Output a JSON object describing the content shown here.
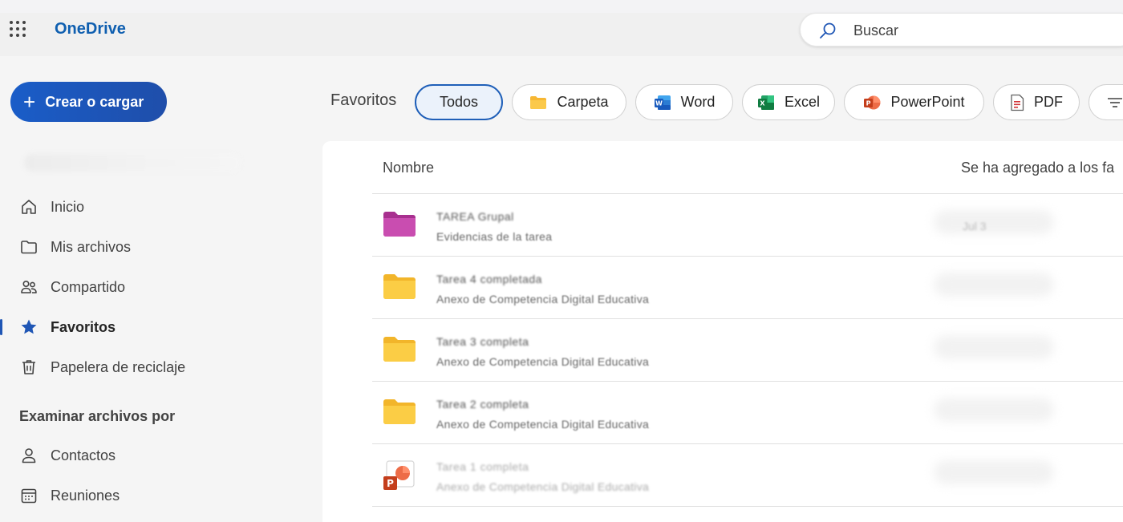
{
  "app": {
    "name": "OneDrive"
  },
  "search": {
    "placeholder": "Buscar"
  },
  "sidebar": {
    "create_label": "Crear o cargar",
    "items": [
      {
        "label": "Inicio",
        "icon": "home-icon"
      },
      {
        "label": "Mis archivos",
        "icon": "folder-icon"
      },
      {
        "label": "Compartido",
        "icon": "people-icon"
      },
      {
        "label": "Favoritos",
        "icon": "star-icon",
        "active": true
      },
      {
        "label": "Papelera de reciclaje",
        "icon": "trash-icon"
      }
    ],
    "browse_heading": "Examinar archivos por",
    "browse_items": [
      {
        "label": "Contactos",
        "icon": "person-icon"
      },
      {
        "label": "Reuniones",
        "icon": "calendar-icon"
      }
    ]
  },
  "filters": {
    "title": "Favoritos",
    "chips": [
      {
        "label": "Todos",
        "selected": true
      },
      {
        "label": "Carpeta",
        "icon": "folder-icon"
      },
      {
        "label": "Word",
        "icon": "word-icon"
      },
      {
        "label": "Excel",
        "icon": "excel-icon"
      },
      {
        "label": "PowerPoint",
        "icon": "powerpoint-icon"
      },
      {
        "label": "PDF",
        "icon": "pdf-icon"
      }
    ]
  },
  "table": {
    "columns": [
      "Nombre",
      "Se ha agregado a los fa"
    ],
    "rows": [
      {
        "type": "folder-shared",
        "name": "TAREA Grupal",
        "location": "Evidencias de la tarea",
        "added": "Jul 3"
      },
      {
        "type": "folder",
        "name": "Tarea 4 completada",
        "location": "Anexo de Competencia Digital Educativa",
        "added": ""
      },
      {
        "type": "folder",
        "name": "Tarea 3 completa",
        "location": "Anexo de Competencia Digital Educativa",
        "added": ""
      },
      {
        "type": "folder",
        "name": "Tarea 2 completa",
        "location": "Anexo de Competencia Digital Educativa",
        "added": ""
      },
      {
        "type": "powerpoint",
        "name": "Tarea 1 completa",
        "location": "Anexo de Competencia Digital Educativa",
        "added": ""
      }
    ]
  },
  "colors": {
    "brand": "#0f5fb0",
    "create_button": "#1a5dc8",
    "folder": "#f7c63b",
    "shared_folder": "#c43fa8",
    "selected_chip_border": "#1f5fb8"
  }
}
